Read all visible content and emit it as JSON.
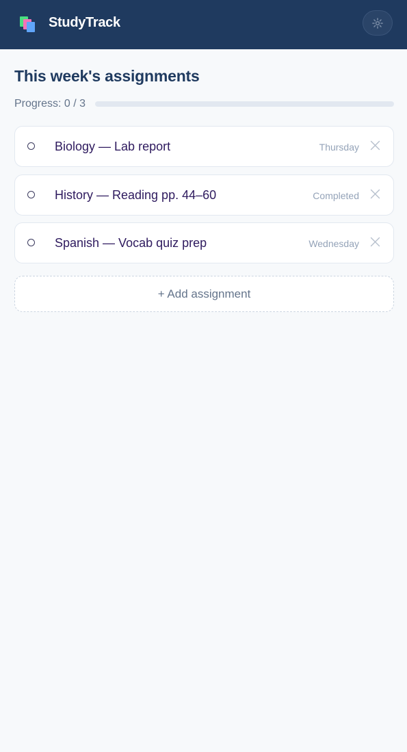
{
  "app": {
    "title": "StudyTrack",
    "logo_icon": "books-icon",
    "settings_icon": "gear-icon"
  },
  "page": {
    "title": "This week's assignments",
    "progress_label": "Progress: 0 / 3",
    "progress_fraction": 0.0
  },
  "assignments": [
    {
      "name": "Biology — Lab report",
      "due": "Thursday",
      "completed": false
    },
    {
      "name": "History — Reading pp. 44–60",
      "due": "Completed",
      "completed": false
    },
    {
      "name": "Spanish — Vocab quiz prep",
      "due": "Wednesday",
      "completed": false
    }
  ],
  "add_button_label": "+ Add assignment",
  "colors": {
    "header": "#1f3a5f",
    "background": "#f7f9fb",
    "task_text": "#2e1a5e",
    "muted": "#94a3b8"
  }
}
